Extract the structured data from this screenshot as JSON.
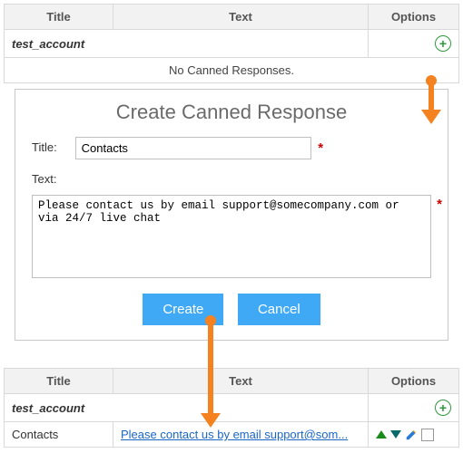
{
  "table_headers": {
    "title": "Title",
    "text": "Text",
    "options": "Options"
  },
  "account": {
    "name": "test_account"
  },
  "empty_msg": "No Canned Responses.",
  "form": {
    "heading": "Create Canned Response",
    "title_label": "Title:",
    "title_value": "Contacts",
    "text_label": "Text:",
    "text_value": "Please contact us by email support@somecompany.com or via 24/7 live chat",
    "create_btn": "Create",
    "cancel_btn": "Cancel"
  },
  "result_row": {
    "title": "Contacts",
    "text": "Please contact us by email support@som..."
  },
  "icons": {
    "plus": "+",
    "req": "*"
  }
}
